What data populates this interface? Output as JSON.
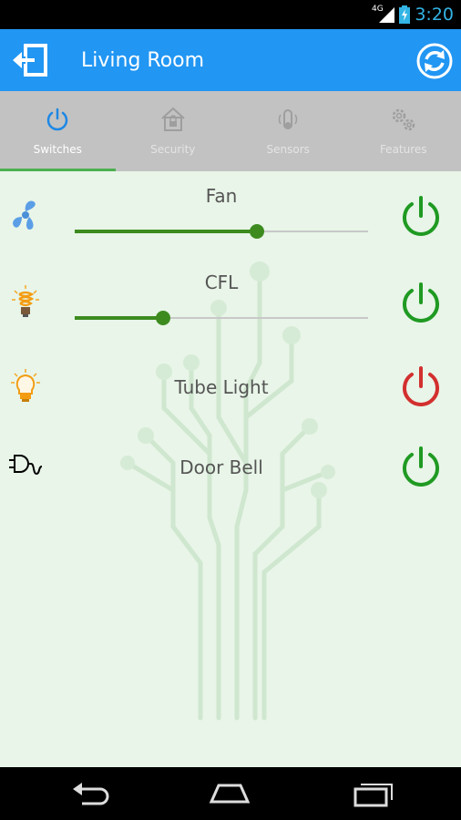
{
  "status_bar": {
    "network": "4G",
    "time": "3:20"
  },
  "action_bar": {
    "title": "Living Room"
  },
  "tabs": [
    {
      "label": "Switches",
      "icon": "power-icon",
      "active": true
    },
    {
      "label": "Security",
      "icon": "house-lock-icon",
      "active": false
    },
    {
      "label": "Sensors",
      "icon": "sensor-icon",
      "active": false
    },
    {
      "label": "Features",
      "icon": "gears-icon",
      "active": false
    }
  ],
  "devices": [
    {
      "name": "Fan",
      "icon": "fan-icon",
      "dimmable": true,
      "level": 0.62,
      "power": "on"
    },
    {
      "name": "CFL",
      "icon": "cfl-bulb-icon",
      "dimmable": true,
      "level": 0.3,
      "power": "on"
    },
    {
      "name": "Tube Light",
      "icon": "bulb-icon",
      "dimmable": false,
      "power": "off"
    },
    {
      "name": "Door Bell",
      "icon": "plug-icon",
      "dimmable": false,
      "power": "on"
    }
  ],
  "colors": {
    "accent": "#2196f3",
    "power_on": "#1f9a22",
    "power_off": "#d32f2f",
    "slider": "#3d8b1f",
    "tab_indicator": "#4caf50"
  }
}
